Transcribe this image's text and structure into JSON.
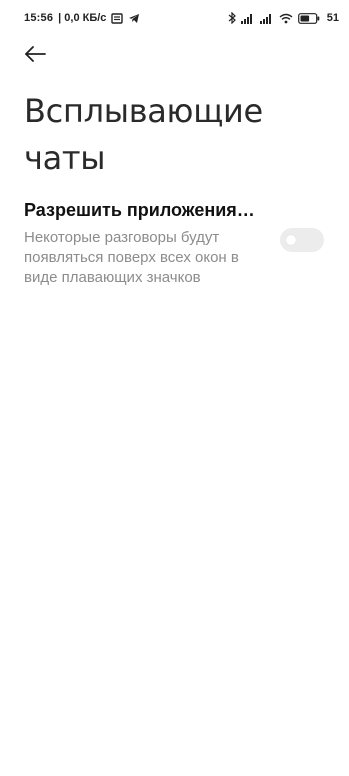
{
  "status_bar": {
    "time": "15:56",
    "speed": "| 0,0 КБ/с",
    "battery": "51",
    "icons": [
      "notification-icon",
      "telegram-icon",
      "bluetooth-icon",
      "signal-icon",
      "signal-icon",
      "wifi-icon",
      "battery-icon"
    ]
  },
  "header": {
    "back_icon": "arrow-left-icon",
    "title": "Всплывающие чаты"
  },
  "setting": {
    "title": "Разрешить приложения…",
    "description": "Некоторые разговоры будут появляться поверх всех окон в виде плавающих значков",
    "toggle_on": false
  },
  "colors": {
    "toggle_off_bg": "#ececec",
    "desc_text": "#8c8c8c"
  }
}
